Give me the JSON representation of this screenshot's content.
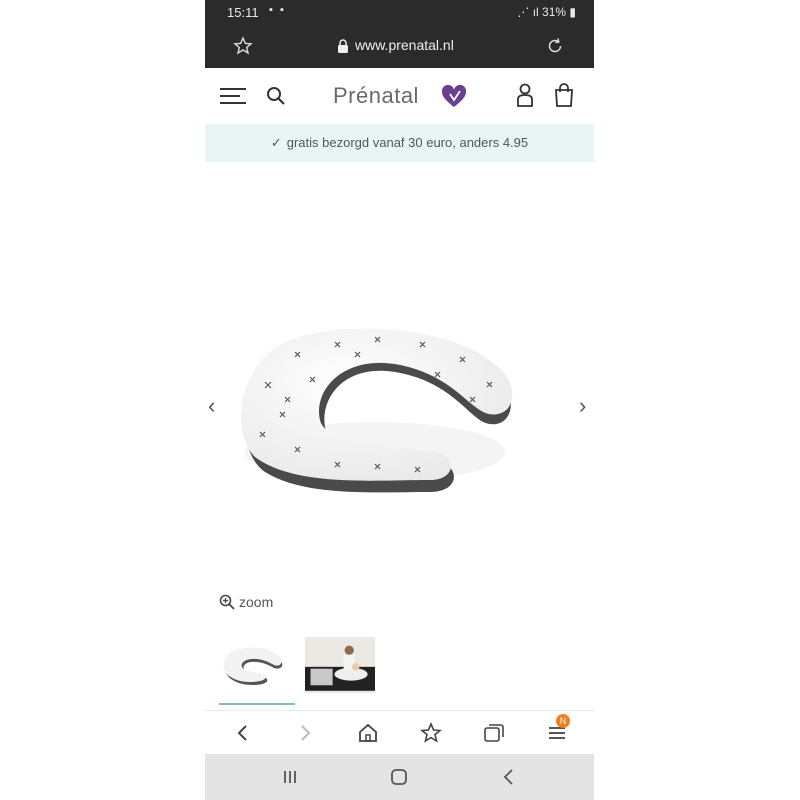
{
  "status_bar": {
    "time": "15:11",
    "battery": "31%"
  },
  "browser": {
    "url": "www.prenatal.nl"
  },
  "header": {
    "brand": "Prénatal"
  },
  "promo": {
    "text": "gratis bezorgd vanaf 30 euro, anders 4.95"
  },
  "gallery": {
    "zoom_label": "zoom"
  },
  "browser_bar": {
    "tab_badge": "N"
  },
  "colors": {
    "dark_bar": "#2b2b2b",
    "promo_bg": "#e9f5f3",
    "brand_heart": "#6b3f8e",
    "accent": "#7fbdb6",
    "badge": "#f0801e"
  },
  "icons": [
    "star-icon",
    "lock-icon",
    "reload-icon",
    "menu-icon",
    "search-icon",
    "heart-logo-icon",
    "user-icon",
    "bag-icon",
    "check-icon",
    "chevron-left-icon",
    "chevron-right-icon",
    "zoom-icon",
    "back-icon",
    "forward-icon",
    "home-icon",
    "bookmark-icon",
    "tabs-icon",
    "browser-menu-icon",
    "recent-apps-icon",
    "home-nav-icon",
    "back-nav-icon"
  ]
}
